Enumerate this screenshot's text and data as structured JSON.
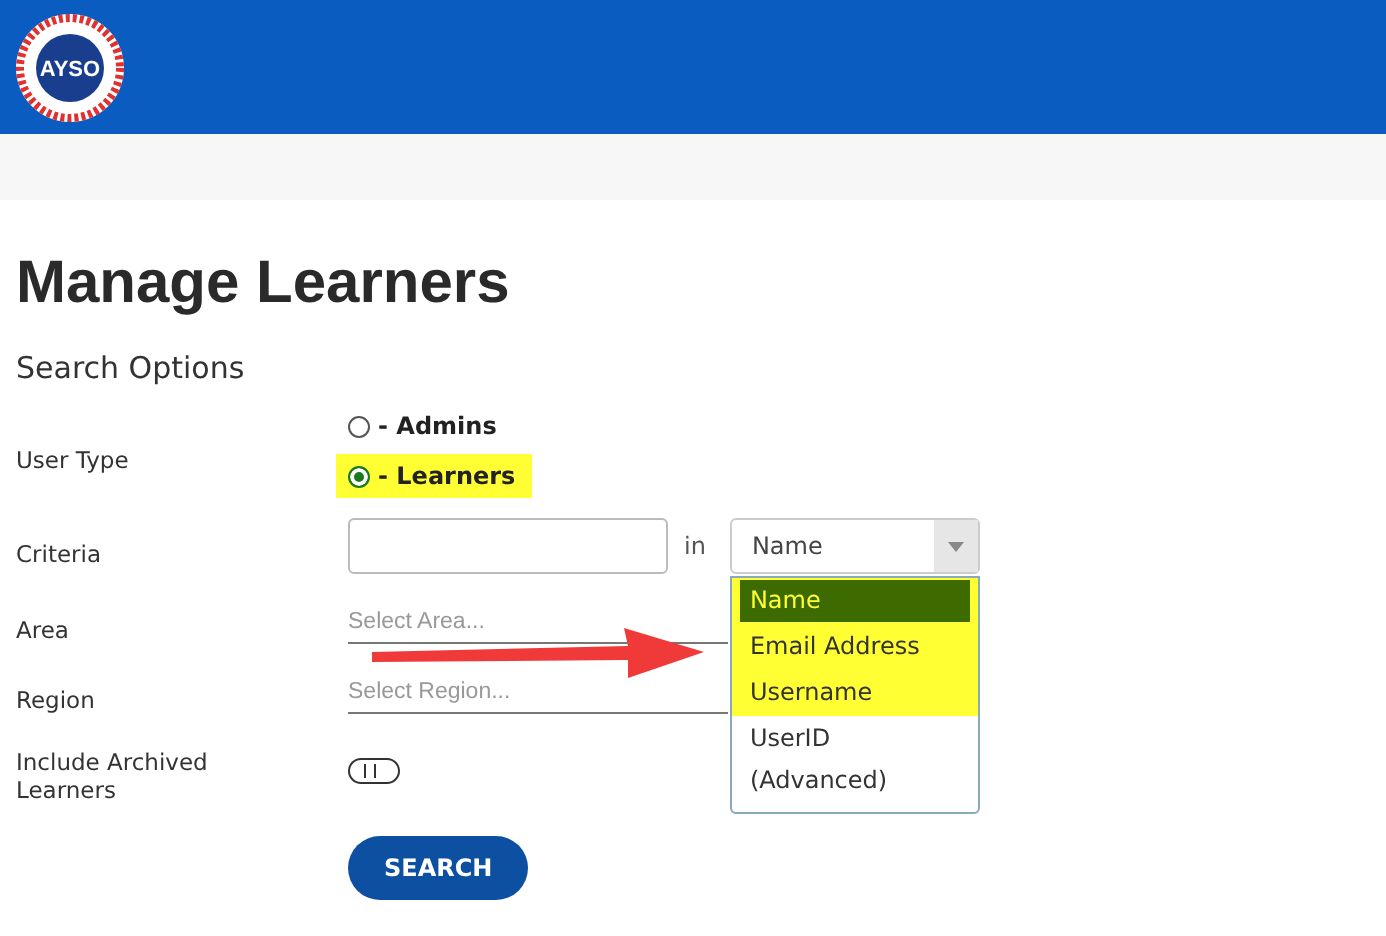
{
  "header": {
    "logo_text": "AYSO"
  },
  "title": "Manage Learners",
  "section": "Search Options",
  "user_type": {
    "label": "User Type",
    "options": [
      {
        "label": "- Admins",
        "selected": false,
        "highlighted": false
      },
      {
        "label": "- Learners",
        "selected": true,
        "highlighted": true
      }
    ]
  },
  "criteria": {
    "label": "Criteria",
    "joiner": "in",
    "select_value": "Name",
    "expanded": true,
    "options": [
      {
        "label": "Name",
        "selected": true,
        "highlighted": true
      },
      {
        "label": "Email Address",
        "selected": false,
        "highlighted": true
      },
      {
        "label": "Username",
        "selected": false,
        "highlighted": true
      },
      {
        "label": "UserID (Advanced)",
        "selected": false,
        "highlighted": false
      }
    ]
  },
  "area": {
    "label": "Area",
    "placeholder": "Select Area..."
  },
  "region": {
    "label": "Region",
    "placeholder": "Select Region..."
  },
  "archived": {
    "label": "Include Archived Learners",
    "on": false
  },
  "search_button": "SEARCH",
  "annotation": {
    "kind": "arrow"
  }
}
